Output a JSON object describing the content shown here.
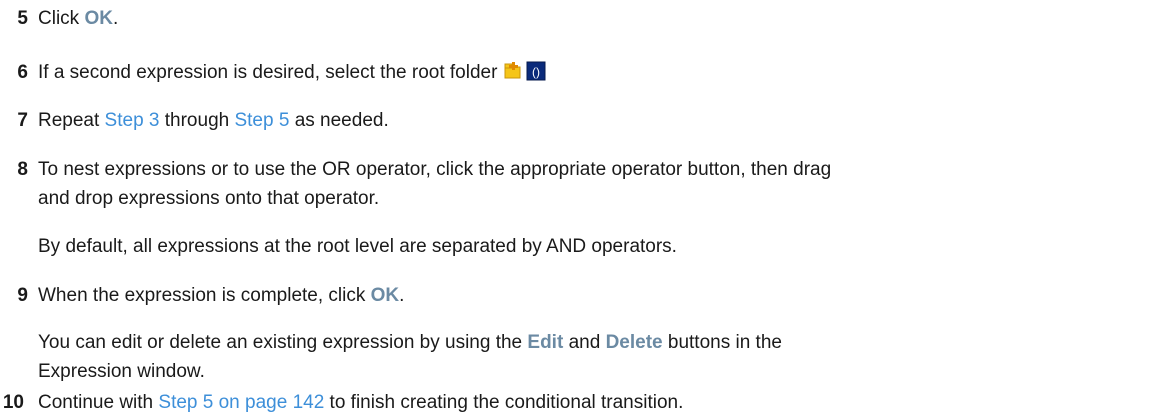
{
  "steps": [
    {
      "num": "5",
      "pre": "Click ",
      "ui": "OK",
      "post": "."
    },
    {
      "num": "6",
      "text": "If a second expression is desired, select the root folder",
      "icons": [
        "folder-icon",
        "expression-icon"
      ]
    },
    {
      "num": "7",
      "pre": "Repeat ",
      "link1": "Step 3",
      "mid": " through ",
      "link2": "Step 5",
      "post": " as needed."
    },
    {
      "num": "8",
      "line1": "To nest expressions or to use the OR operator, click the appropriate operator button, then drag",
      "line2": "and drop expressions onto that operator."
    },
    {
      "note": "By default, all expressions at the root level are separated by AND operators."
    },
    {
      "num": "9",
      "pre": "When the expression is complete, click ",
      "ui": "OK",
      "post": "."
    },
    {
      "note_pre": "You can edit or delete an existing expression by using the ",
      "ui1": "Edit",
      "mid": " and ",
      "ui2": "Delete",
      "note_post": " buttons in the",
      "line2": "Expression window."
    },
    {
      "num": "10",
      "pre": "Continue with ",
      "link": "Step 5 on page 142",
      "post": " to finish creating the conditional transition."
    }
  ]
}
